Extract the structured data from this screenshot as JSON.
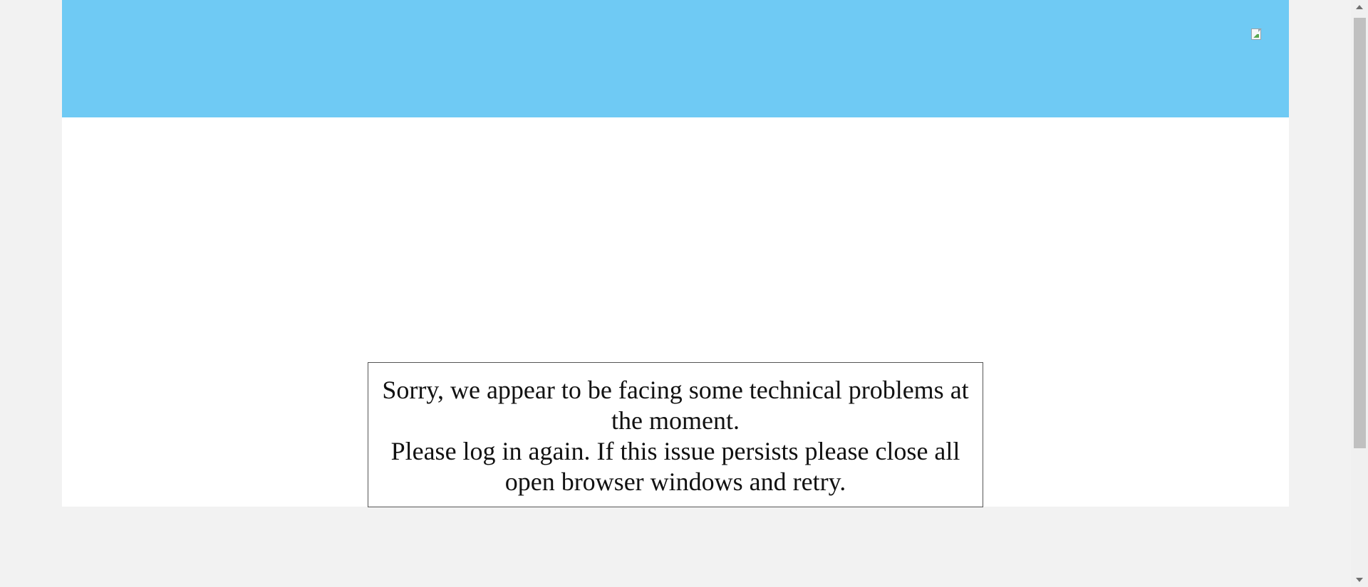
{
  "header": {
    "background_color": "#6fcaf4",
    "image": {
      "icon": "broken-image-icon"
    }
  },
  "error": {
    "line1": "Sorry, we appear to be facing some technical problems at the moment.",
    "line2": "Please log in again. If this issue persists please close all open browser windows and retry."
  },
  "scrollbar": {
    "up_icon": "scroll-up-arrow-icon",
    "down_icon": "scroll-down-arrow-icon"
  }
}
